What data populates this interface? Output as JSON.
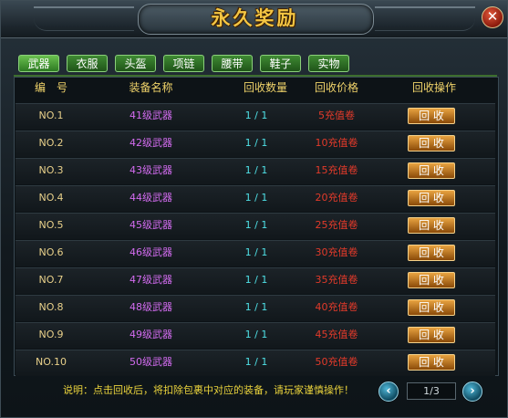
{
  "title": "永久奖励",
  "close_label": "✕",
  "tabs": [
    {
      "label": "武器",
      "active": true
    },
    {
      "label": "衣服",
      "active": false
    },
    {
      "label": "头盔",
      "active": false
    },
    {
      "label": "项链",
      "active": false
    },
    {
      "label": "腰带",
      "active": false
    },
    {
      "label": "鞋子",
      "active": false
    },
    {
      "label": "实物",
      "active": false
    }
  ],
  "columns": [
    "编　号",
    "装备名称",
    "回收数量",
    "回收价格",
    "回收操作"
  ],
  "rows": [
    {
      "id": "NO.1",
      "name": "41级武器",
      "qty": "1 / 1",
      "price": "5充值卷",
      "action": "回 收"
    },
    {
      "id": "NO.2",
      "name": "42级武器",
      "qty": "1 / 1",
      "price": "10充值卷",
      "action": "回 收"
    },
    {
      "id": "NO.3",
      "name": "43级武器",
      "qty": "1 / 1",
      "price": "15充值卷",
      "action": "回 收"
    },
    {
      "id": "NO.4",
      "name": "44级武器",
      "qty": "1 / 1",
      "price": "20充值卷",
      "action": "回 收"
    },
    {
      "id": "NO.5",
      "name": "45级武器",
      "qty": "1 / 1",
      "price": "25充值卷",
      "action": "回 收"
    },
    {
      "id": "NO.6",
      "name": "46级武器",
      "qty": "1 / 1",
      "price": "30充值卷",
      "action": "回 收"
    },
    {
      "id": "NO.7",
      "name": "47级武器",
      "qty": "1 / 1",
      "price": "35充值卷",
      "action": "回 收"
    },
    {
      "id": "NO.8",
      "name": "48级武器",
      "qty": "1 / 1",
      "price": "40充值卷",
      "action": "回 收"
    },
    {
      "id": "NO.9",
      "name": "49级武器",
      "qty": "1 / 1",
      "price": "45充值卷",
      "action": "回 收"
    },
    {
      "id": "NO.10",
      "name": "50级武器",
      "qty": "1 / 1",
      "price": "50充值卷",
      "action": "回 收"
    }
  ],
  "footer": {
    "note": "说明：点击回收后，将扣除包裹中对应的装备，请玩家谨慎操作！",
    "page": "1/3",
    "prev_icon": "chevron-left-icon",
    "next_icon": "chevron-right-icon",
    "prev_glyph": "‹",
    "next_glyph": "›"
  },
  "colors": {
    "title": "#f4c542",
    "header_text": "#f0d36a",
    "id_text": "#e8d08a",
    "name_text": "#d36cf0",
    "qty_text": "#4fe0e6",
    "price_text": "#e23a2a",
    "tab_green": "#3f8a33",
    "button_orange": "#e8a340",
    "note_text": "#e9d23c"
  }
}
